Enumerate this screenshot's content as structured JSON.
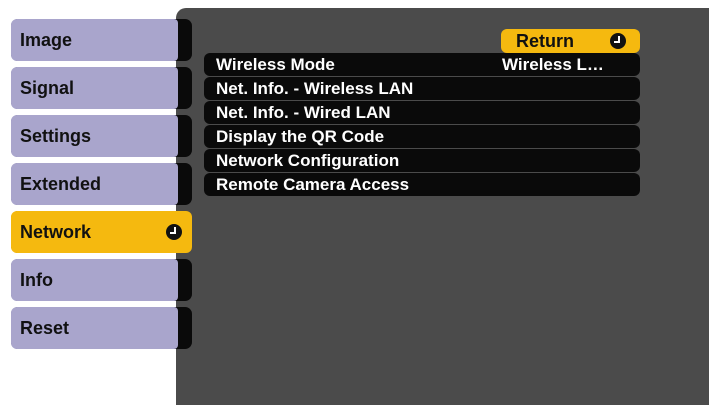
{
  "sidebar": {
    "tabs": [
      {
        "label": "Image"
      },
      {
        "label": "Signal"
      },
      {
        "label": "Settings"
      },
      {
        "label": "Extended"
      },
      {
        "label": "Network"
      },
      {
        "label": "Info"
      },
      {
        "label": "Reset"
      }
    ],
    "active_tab": "Network",
    "active_icon": "enter-icon"
  },
  "submenu": {
    "return_label": "Return",
    "return_icon": "enter-icon",
    "items": [
      {
        "label": "Wireless Mode",
        "value": "Wireless L…"
      },
      {
        "label": "Net. Info. - Wireless LAN"
      },
      {
        "label": "Net. Info. - Wired LAN"
      },
      {
        "label": "Display the QR Code"
      },
      {
        "label": "Network Configuration"
      },
      {
        "label": "Remote Camera Access"
      }
    ]
  },
  "colors": {
    "tab_background": "#a9a5cc",
    "highlight": "#f5b90f",
    "panel_background": "#4b4b4b",
    "item_background": "#0a0a0a",
    "item_text": "#ffffff"
  }
}
